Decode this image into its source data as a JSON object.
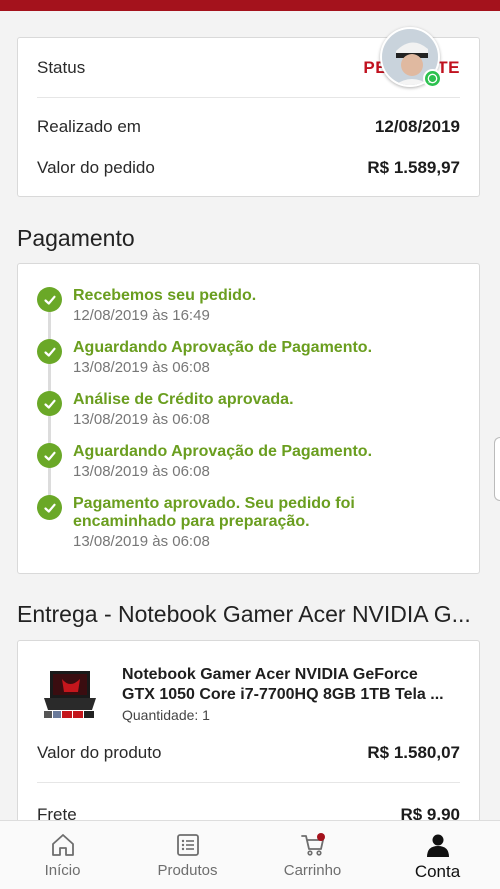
{
  "order_card": {
    "status_label": "Status",
    "status_value": "PENDENTE",
    "realizado_label": "Realizado em",
    "realizado_value": "12/08/2019",
    "valor_label": "Valor do pedido",
    "valor_value": "R$ 1.589,97"
  },
  "pagamento": {
    "title": "Pagamento",
    "steps": [
      {
        "title": "Recebemos seu pedido.",
        "date": "12/08/2019 às 16:49"
      },
      {
        "title": "Aguardando Aprovação de Pagamento.",
        "date": "13/08/2019 às 06:08"
      },
      {
        "title": "Análise de Crédito aprovada.",
        "date": "13/08/2019 às 06:08"
      },
      {
        "title": "Aguardando Aprovação de Pagamento.",
        "date": "13/08/2019 às 06:08"
      },
      {
        "title_line1": "Pagamento aprovado. Seu pedido foi",
        "title_line2": "encaminhado para preparação.",
        "date": "13/08/2019 às 06:08"
      }
    ],
    "step_color": "#6aa827"
  },
  "entrega": {
    "title": "Entrega - Notebook Gamer Acer NVIDIA G...",
    "product_line1": "Notebook Gamer Acer NVIDIA GeForce",
    "product_line2": "GTX 1050 Core i7-7700HQ 8GB 1TB Tela ...",
    "quantity": "Quantidade: 1",
    "valor_produto_label": "Valor do produto",
    "valor_produto_value": "R$ 1.580,07",
    "frete_label": "Frete",
    "frete_value": "R$ 9,90"
  },
  "nav": {
    "inicio": "Início",
    "produtos": "Produtos",
    "carrinho": "Carrinho",
    "conta": "Conta"
  },
  "colors": {
    "brand": "#a4121c",
    "success": "#6aa827"
  }
}
